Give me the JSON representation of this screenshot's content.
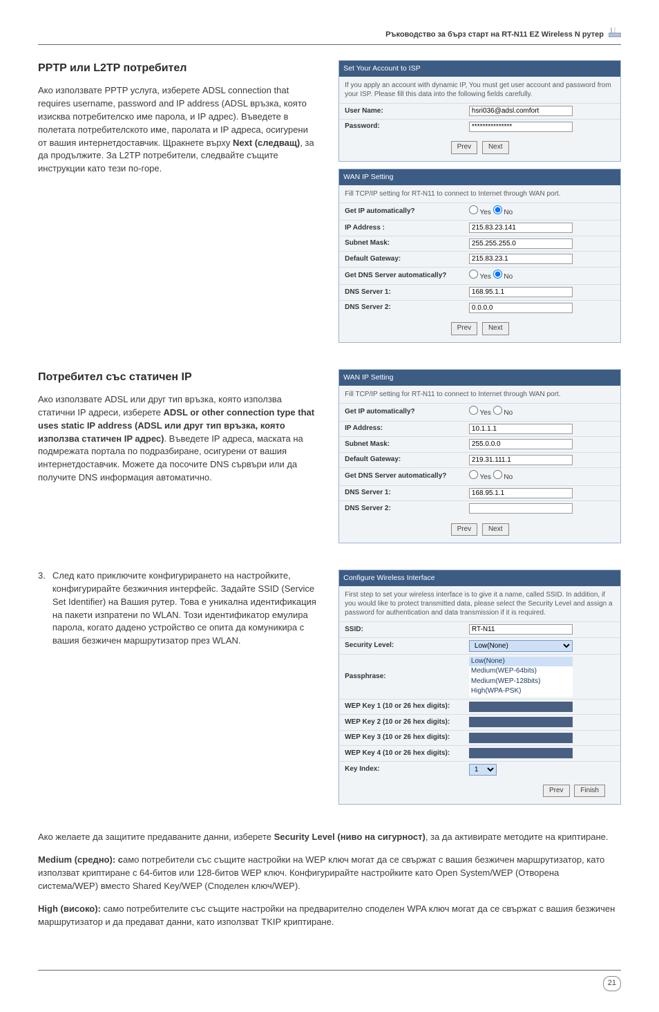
{
  "header": {
    "title": "Ръководство за бърз старт на RT-N11 EZ Wireless N рутер"
  },
  "section1": {
    "heading": "PPTP или L2TP потребител",
    "body": "Ако използвате PPTP услуга, изберете ADSL connection that requires username, password and IP address (ADSL връзка, която изисква потребителско име парола, и IP адрес). Въведете в полетата потребителското име, паролата и IP адреса, осигурени от вашия интернетдоставчик. Щракнете върху ",
    "body_bold": "Next (следващ)",
    "body_tail": ", за да продължите. За L2TP потребители, следвайте същите инструкции като тези по-горе."
  },
  "panel_isp": {
    "title": "Set Your Account to ISP",
    "desc": "If you apply an account with dynamic IP, You must get user account and password from your ISP. Please fill this data into the following fields carefully.",
    "rows": [
      {
        "label": "User Name:",
        "value": "hsri036@adsl.comfort"
      },
      {
        "label": "Password:",
        "value": "***************"
      }
    ],
    "prev": "Prev",
    "next": "Next"
  },
  "panel_wan1": {
    "title": "WAN IP Setting",
    "desc": "Fill TCP/IP setting for RT-N11 to connect to Internet through WAN port.",
    "rows": {
      "getip_label": "Get IP automatically?",
      "getip_yes": "Yes",
      "getip_no": "No",
      "ip_label": "IP Address :",
      "ip_val": "215.83.23.141",
      "mask_label": "Subnet Mask:",
      "mask_val": "255.255.255.0",
      "gw_label": "Default Gateway:",
      "gw_val": "215.83.23.1",
      "getdns_label": "Get DNS Server automatically?",
      "getdns_yes": "Yes",
      "getdns_no": "No",
      "dns1_label": "DNS Server 1:",
      "dns1_val": "168.95.1.1",
      "dns2_label": "DNS Server 2:",
      "dns2_val": "0.0.0.0"
    },
    "prev": "Prev",
    "next": "Next"
  },
  "section2": {
    "heading": "Потребител със статичен IP",
    "body_a": "Ако използвате ADSL или друг тип връзка, която използва статични IP адреси, изберете ",
    "body_bold": "ADSL or other connection type that uses static IP address (ADSL или друг тип връзка, която използва статичен IP адрес)",
    "body_b": ". Въведете IP адреса, маската на подмрежата портала по подразбиране, осигурени от вашия интернетдоставчик. Можете да посочите DNS сървъри или да получите DNS информация автоматично."
  },
  "panel_wan2": {
    "title": "WAN IP Setting",
    "desc": "Fill TCP/IP setting for RT-N11 to connect to Internet through WAN port.",
    "rows": {
      "getip_label": "Get IP automatically?",
      "getip_yes": "Yes",
      "getip_no": "No",
      "ip_label": "IP Address:",
      "ip_val": "10.1.1.1",
      "mask_label": "Subnet Mask:",
      "mask_val": "255.0.0.0",
      "gw_label": "Default Gateway:",
      "gw_val": "219.31.111.1",
      "getdns_label": "Get DNS Server automatically?",
      "getdns_yes": "Yes",
      "getdns_no": "No",
      "dns1_label": "DNS Server 1:",
      "dns1_val": "168.95.1.1",
      "dns2_label": "DNS Server 2:",
      "dns2_val": ""
    },
    "prev": "Prev",
    "next": "Next"
  },
  "step3": {
    "num": "3.",
    "text": "След като приключите конфигурирането на настройките, конфигурирайте безжичния интерфейс. Задайте SSID (Service Set Identifier) на Вашия рутер. Това е уникална идентификация на пакети изпратени по WLAN. Този идентификатор емулира парола, когато дадено устройство се опита да комуникира с вашия безжичен маршрутизатор през WLAN."
  },
  "panel_wifi": {
    "title": "Configure Wireless Interface",
    "desc": "First step to set your wireless interface is to give it a name, called SSID. In addition, if you would like to protect transmitted data, please select the Security Level and assign a password for authentication and data transmission if it is required.",
    "rows": {
      "ssid_label": "SSID:",
      "ssid_val": "RT-N11",
      "sec_label": "Security Level:",
      "sec_sel": "Low(None)",
      "sec_opts": [
        "Low(None)",
        "Medium(WEP-64bits)",
        "Medium(WEP-128bits)",
        "High(WPA-PSK)"
      ],
      "pass_label": "Passphrase:",
      "w1_label": "WEP Key 1 (10 or 26 hex digits):",
      "w2_label": "WEP Key 2 (10 or 26 hex digits):",
      "w3_label": "WEP Key 3 (10 or 26 hex digits):",
      "w4_label": "WEP Key 4 (10 or 26 hex digits):",
      "ki_label": "Key Index:",
      "ki_val": "1"
    },
    "prev": "Prev",
    "finish": "Finish"
  },
  "bottom": {
    "p1a": "Ако желаете да защитите предаваните данни, изберете ",
    "p1bold": "Security Level (ниво на сигурност)",
    "p1b": ", за да активирате методите на криптиране.",
    "p2bold": "Medium (средно): с",
    "p2": "амо потребители със същите настройки на WEP ключ могат да се свържат с вашия безжичен маршрутизатор, като използват криптиране с 64-битов или 128-битов WEP ключ. Конфигурирайте настройките като Open System/WEP (Отворена система/WEP) вместо Shared Key/WEP (Споделен ключ/WEP).",
    "p3bold": "High (високо):",
    "p3": " само потребителите със същите настройки на предварително споделен WPA ключ могат да се свържат с вашия безжичен маршрутизатор и да предават данни, като използват TKIP криптиране."
  },
  "page_number": "21"
}
